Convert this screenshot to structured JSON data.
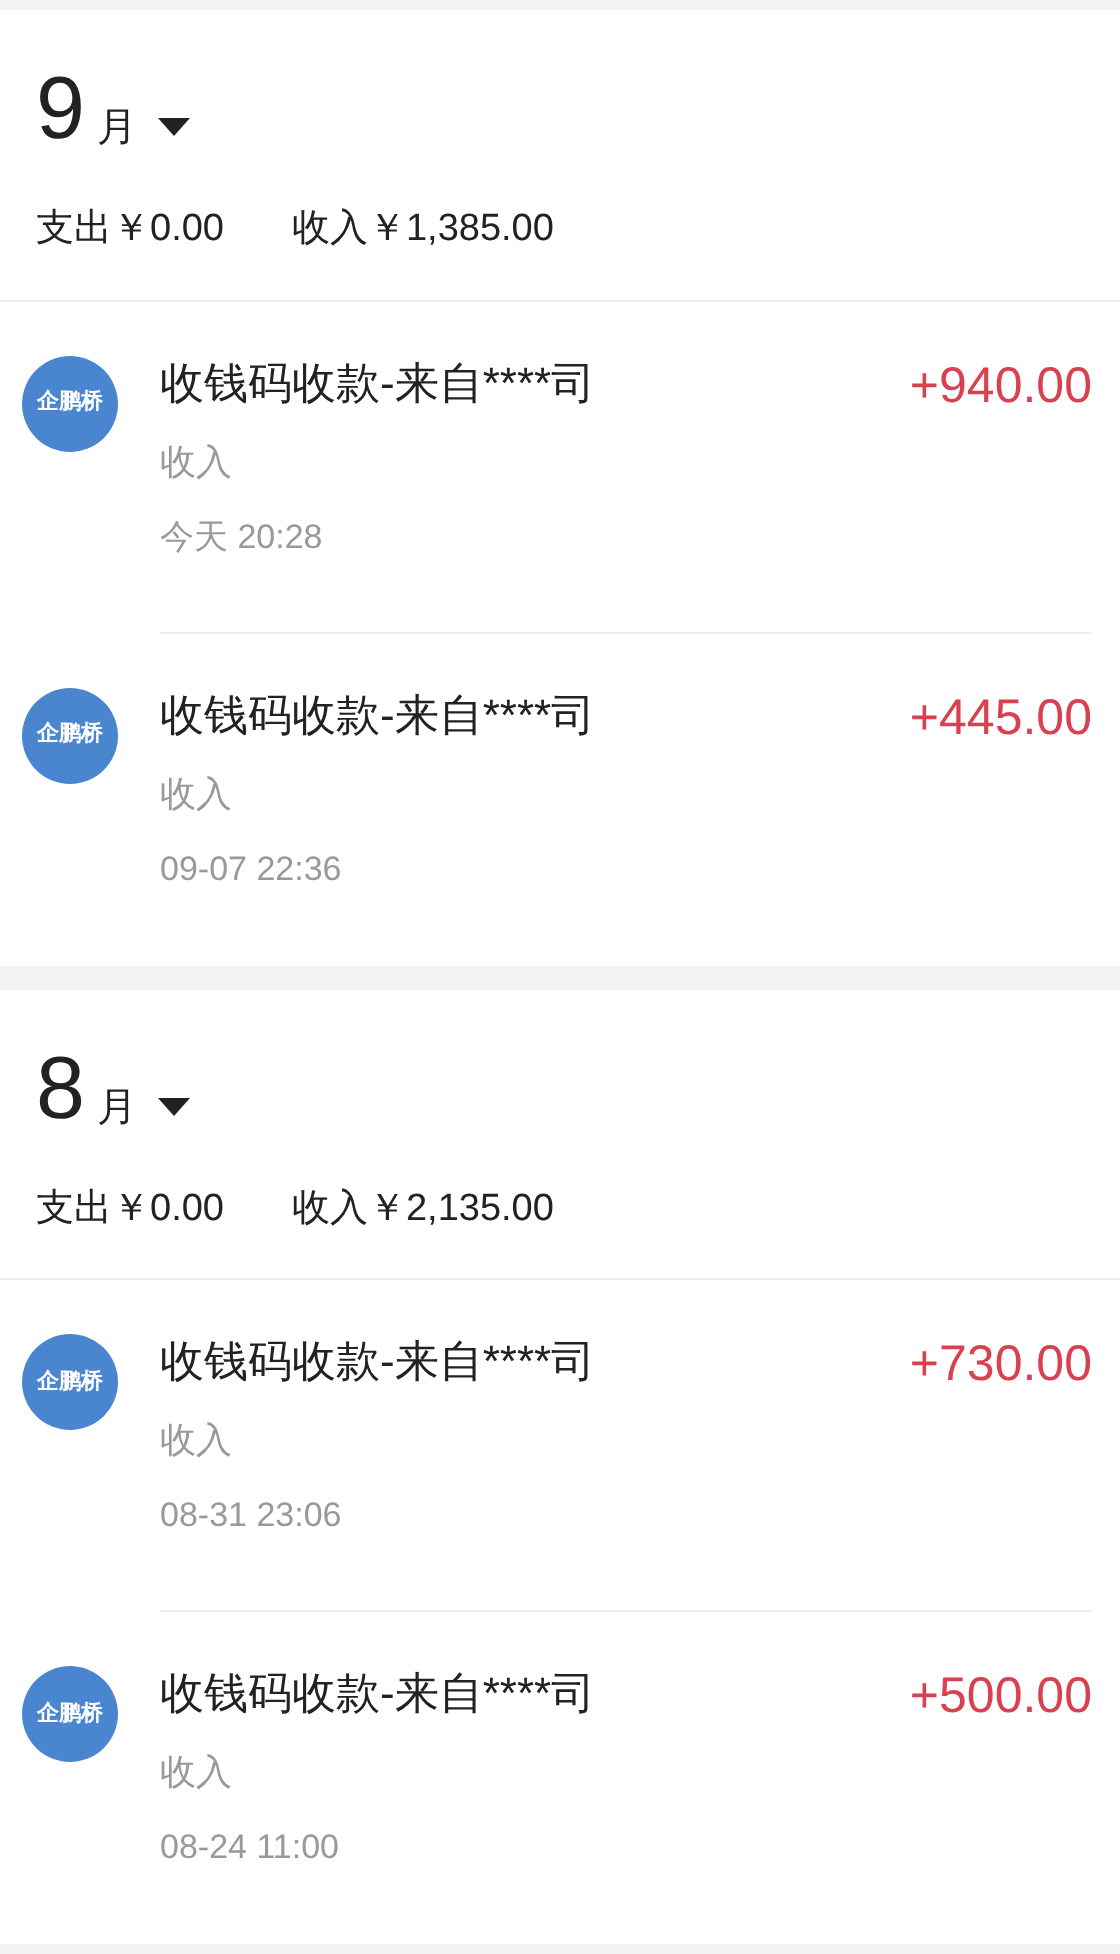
{
  "months": [
    {
      "month": "9",
      "unit": "月",
      "expense": "支出￥0.00",
      "income": "收入￥1,385.00",
      "records": [
        {
          "logo": "企鹏桥",
          "title": "收钱码收款-来自****司",
          "category": "收入",
          "time": "今天 20:28",
          "amount": "+940.00"
        },
        {
          "logo": "企鹏桥",
          "title": "收钱码收款-来自****司",
          "category": "收入",
          "time": "09-07 22:36",
          "amount": "+445.00"
        }
      ]
    },
    {
      "month": "8",
      "unit": "月",
      "expense": "支出￥0.00",
      "income": "收入￥2,135.00",
      "records": [
        {
          "logo": "企鹏桥",
          "title": "收钱码收款-来自****司",
          "category": "收入",
          "time": "08-31 23:06",
          "amount": "+730.00"
        },
        {
          "logo": "企鹏桥",
          "title": "收钱码收款-来自****司",
          "category": "收入",
          "time": "08-24 11:00",
          "amount": "+500.00"
        }
      ]
    }
  ]
}
